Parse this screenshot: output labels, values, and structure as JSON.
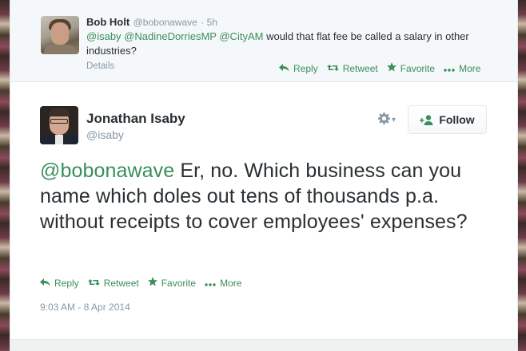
{
  "colors": {
    "link": "#3a8e5b",
    "text": "#292f33",
    "muted": "#8899a6",
    "ancestor_bg": "#f5f8fa"
  },
  "reply_tweet": {
    "fullname": "Bob Holt",
    "username": "@bobonawave",
    "time": "· 5h",
    "mentions": [
      "@isaby",
      "@NadineDorriesMP",
      "@CityAM"
    ],
    "text": "would that flat fee be called a salary in other industries?",
    "details_label": "Details",
    "actions": {
      "reply": "Reply",
      "retweet": "Retweet",
      "favorite": "Favorite",
      "more": "More"
    }
  },
  "main_tweet": {
    "fullname": "Jonathan Isaby",
    "username": "@isaby",
    "mention": "@bobonawave",
    "text": "Er, no. Which business can you name which doles out tens of thousands p.a. without receipts to cover employees' expenses?",
    "follow_label": "Follow",
    "actions": {
      "reply": "Reply",
      "retweet": "Retweet",
      "favorite": "Favorite",
      "more": "More"
    },
    "timestamp": "9:03 AM - 8 Apr 2014"
  },
  "icons": {
    "reply": "reply-arrow-icon",
    "retweet": "retweet-icon",
    "favorite": "star-icon",
    "more": "ellipsis-icon",
    "gear": "gear-icon",
    "follow": "add-user-icon"
  }
}
